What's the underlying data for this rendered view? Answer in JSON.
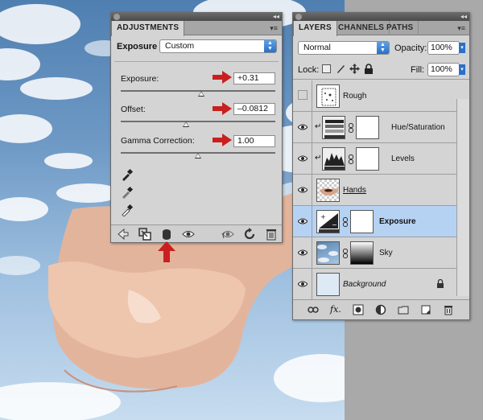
{
  "adjustments": {
    "tab_label": "ADJUSTMENTS",
    "preset_label": "Exposure",
    "preset_value": "Custom",
    "exposure_label": "Exposure:",
    "exposure_value": "+0.31",
    "exposure_level": 0.52,
    "offset_label": "Offset:",
    "offset_value": "–0.0812",
    "offset_level": 0.42,
    "gamma_label": "Gamma Correction:",
    "gamma_value": "1.00",
    "gamma_level": 0.5
  },
  "layers_panel": {
    "tabs": [
      "LAYERS",
      "CHANNELS",
      "PATHS"
    ],
    "blend_mode": "Normal",
    "opacity_label": "Opacity:",
    "opacity_value": "100%",
    "lock_label": "Lock:",
    "fill_label": "Fill:",
    "fill_value": "100%",
    "layers": [
      {
        "name": "Rough",
        "visible": false
      },
      {
        "name": "Hue/Saturation",
        "visible": true
      },
      {
        "name": "Levels",
        "visible": true
      },
      {
        "name": "Hands",
        "visible": true
      },
      {
        "name": "Exposure",
        "visible": true,
        "selected": true
      },
      {
        "name": "Sky",
        "visible": true
      },
      {
        "name": "Background",
        "visible": true,
        "locked": true
      }
    ]
  },
  "colors": {
    "highlight_arrow": "#c8201e",
    "selected_row": "#b6d2f3",
    "panel_bg": "#d4d4d4",
    "select_accent": "#2a6fc9"
  }
}
